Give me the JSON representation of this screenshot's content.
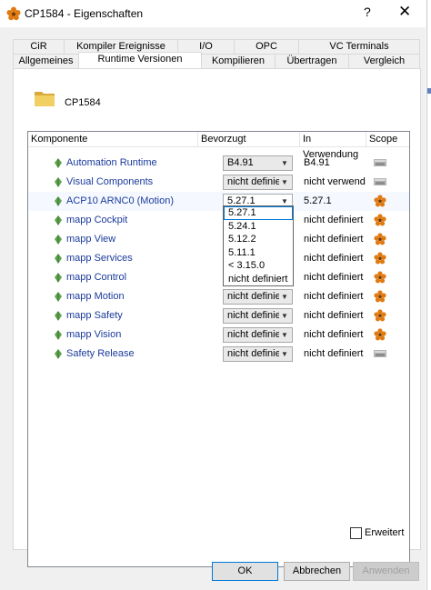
{
  "window": {
    "title": "CP1584 - Eigenschaften",
    "help": "?",
    "close": "✕"
  },
  "tabs": {
    "row1": [
      "CiR",
      "Kompiler Ereignisse",
      "I/O",
      "OPC",
      "VC Terminals"
    ],
    "row2": [
      "Allgemeines",
      "Runtime Versionen",
      "Kompilieren",
      "Übertragen",
      "Vergleich"
    ],
    "active": "Runtime Versionen"
  },
  "device": {
    "name": "CP1584"
  },
  "grid": {
    "headers": {
      "component": "Komponente",
      "preferred": "Bevorzugt",
      "in_use": "In Verwendung",
      "scope": "Scope"
    },
    "rows": [
      {
        "name": "Automation Runtime",
        "preferred": "B4.91",
        "in_use": "B4.91",
        "scope_icon": "generic-scope-icon"
      },
      {
        "name": "Visual Components",
        "preferred": "nicht definiert",
        "in_use": "nicht verwendet",
        "scope_icon": "generic-scope-icon"
      },
      {
        "name": "ACP10 ARNC0 (Motion)",
        "preferred": "5.27.1",
        "in_use": "5.27.1",
        "scope_icon": "flower-scope-icon"
      },
      {
        "name": "mapp Cockpit",
        "preferred": "",
        "in_use": "nicht definiert",
        "scope_icon": "flower-scope-icon"
      },
      {
        "name": "mapp View",
        "preferred": "",
        "in_use": "nicht definiert",
        "scope_icon": "flower-scope-icon"
      },
      {
        "name": "mapp Services",
        "preferred": "",
        "in_use": "nicht definiert",
        "scope_icon": "flower-scope-icon"
      },
      {
        "name": "mapp Control",
        "preferred": "",
        "in_use": "nicht definiert",
        "scope_icon": "flower-scope-icon"
      },
      {
        "name": "mapp Motion",
        "preferred": "nicht definiert",
        "in_use": "nicht definiert",
        "scope_icon": "flower-scope-icon"
      },
      {
        "name": "mapp Safety",
        "preferred": "nicht definiert",
        "in_use": "nicht definiert",
        "scope_icon": "flower-scope-icon"
      },
      {
        "name": "mapp Vision",
        "preferred": "nicht definiert",
        "in_use": "nicht definiert",
        "scope_icon": "flower-scope-icon"
      },
      {
        "name": "Safety Release",
        "preferred": "nicht definiert",
        "in_use": "nicht definiert",
        "scope_icon": "generic-scope-icon"
      }
    ]
  },
  "dropdown": {
    "options": [
      "5.27.1",
      "5.24.1",
      "5.12.2",
      "5.11.1",
      "< 3.15.0",
      "nicht definiert"
    ],
    "selected": "5.27.1"
  },
  "footer": {
    "advanced_label": "Erweitert",
    "ok": "OK",
    "cancel": "Abbrechen",
    "apply": "Anwenden"
  },
  "colors": {
    "accent": "#0078d7",
    "link_text": "#1a3a9c",
    "leaf_green": "#5fa14f",
    "scope_orange": "#e07a10"
  }
}
